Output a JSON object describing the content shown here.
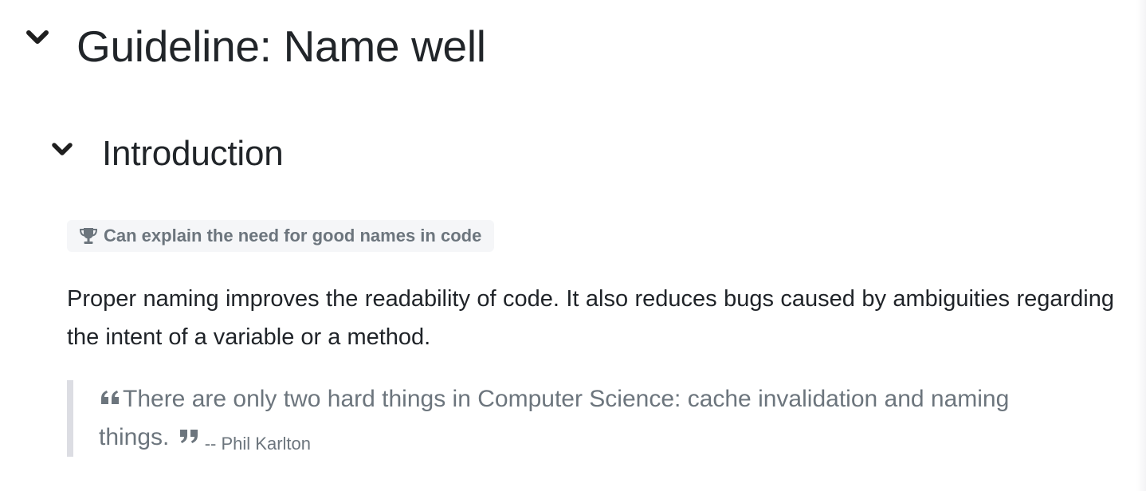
{
  "guideline": {
    "title": "Guideline: Name well",
    "expand_icon": "chevron-down-icon"
  },
  "section": {
    "title": "Introduction",
    "expand_icon": "chevron-down-icon"
  },
  "outcome": {
    "icon": "trophy-icon",
    "text": "Can explain the need for good names in code"
  },
  "body": {
    "paragraph": "Proper naming improves the readability of code. It also reduces bugs caused by ambiguities regarding the intent of a variable or a method."
  },
  "quote": {
    "open_icon": "quote-left-icon",
    "text_line1": "There are only two hard things in Computer Science: cache invalidation and naming",
    "text_line2": "things.",
    "close_icon": "quote-right-icon",
    "author": "-- Phil Karlton"
  },
  "colors": {
    "text": "#212529",
    "muted": "#6c757d",
    "badge_bg": "#f5f6f8",
    "quote_border": "#dcdde3"
  }
}
